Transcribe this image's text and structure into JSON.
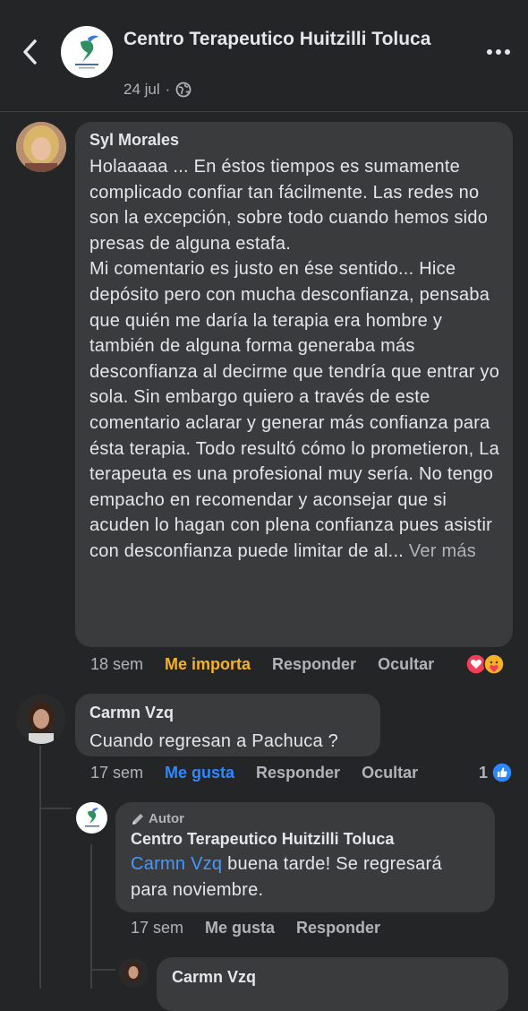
{
  "header": {
    "page_name": "Centro Terapeutico Huitzilli Toluca",
    "date": "24 jul",
    "separator": "·",
    "icons": {
      "back": "chevron-left-icon",
      "privacy": "globe-icon",
      "more": "more-horizontal-icon"
    }
  },
  "comments": [
    {
      "author": "Syl Morales",
      "paragraph1": "Holaaaaa ... En éstos tiempos es sumamente complicado confiar tan fácilmente. Las redes no son la excepción, sobre todo cuando hemos sido presas de alguna estafa.",
      "paragraph2": "Mi comentario es justo en ése sentido... Hice depósito pero con mucha desconfianza, pensaba que quién me daría la terapia era hombre y también de alguna forma generaba más desconfianza al decirme que tendría que entrar yo sola. Sin embargo quiero a través de este comentario aclarar y generar más confianza para ésta terapia. Todo resultó cómo lo prometieron, La terapeuta es una profesional muy sería. No tengo empacho en recomendar y aconsejar que si acuden lo hagan con plena confianza pues asistir con desconfianza puede limitar de al...",
      "see_more": "Ver más",
      "time": "18 sem",
      "reaction_label": "Me importa",
      "reply": "Responder",
      "hide": "Ocultar",
      "reactions": [
        "heart-icon",
        "care-icon"
      ]
    },
    {
      "author": "Carmn Vzq",
      "text": "Cuando regresan a Pachuca ?",
      "time": "17 sem",
      "reaction_label": "Me gusta",
      "reply": "Responder",
      "hide": "Ocultar",
      "like_count": "1",
      "reactions": [
        "like-icon"
      ]
    }
  ],
  "replies": [
    {
      "badge": "Autor",
      "author": "Centro Terapeutico Huitzilli Toluca",
      "mention": "Carmn Vzq",
      "text": " buena tarde! Se regresará para noviembre.",
      "time": "17 sem",
      "reaction_label": "Me gusta",
      "reply": "Responder"
    },
    {
      "author": "Carmn Vzq"
    }
  ],
  "colors": {
    "background": "#242526",
    "bubble": "#3a3b3c",
    "text": "#e4e6eb",
    "secondary": "#b0b3b8",
    "orange_reaction": "#f7b125",
    "blue_link": "#2d88ff"
  }
}
